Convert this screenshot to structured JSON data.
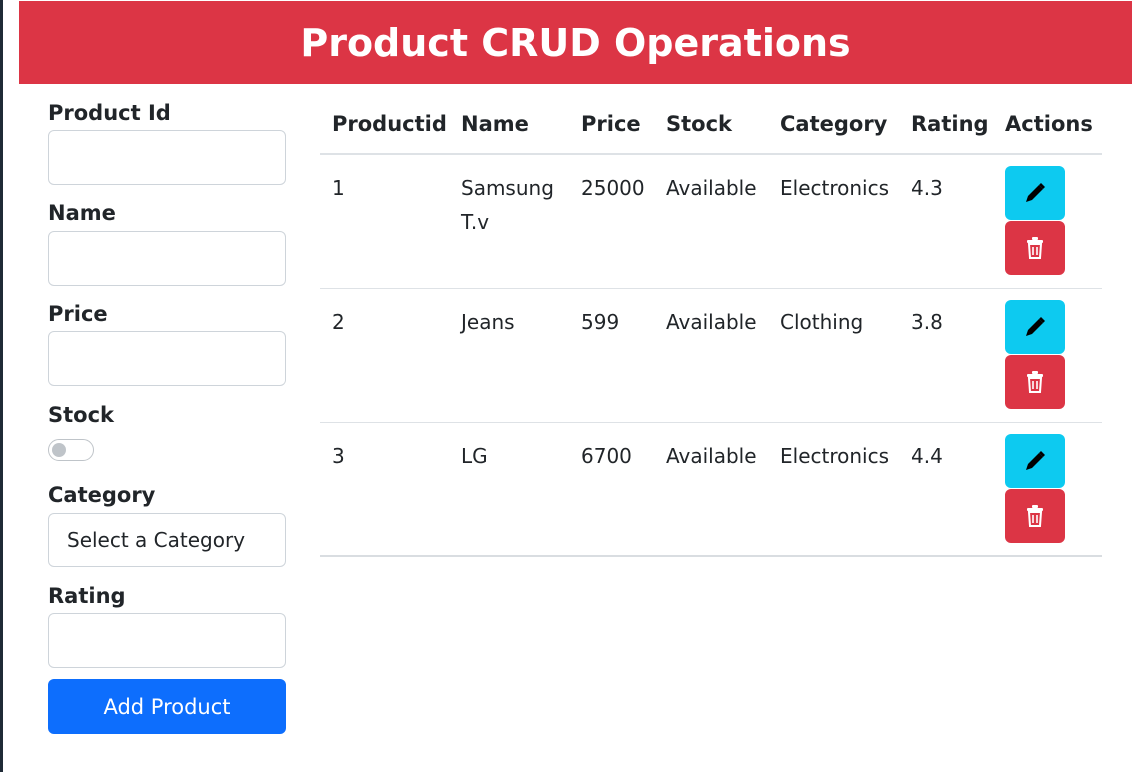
{
  "header": {
    "title": "Product CRUD Operations"
  },
  "form": {
    "product_id_label": "Product Id",
    "product_id_value": "",
    "name_label": "Name",
    "name_value": "",
    "price_label": "Price",
    "price_value": "",
    "stock_label": "Stock",
    "stock_toggle_on": false,
    "category_label": "Category",
    "category_selected": "Select a Category",
    "rating_label": "Rating",
    "rating_value": "",
    "add_button_label": "Add Product"
  },
  "table": {
    "columns": [
      "Productid",
      "Name",
      "Price",
      "Stock",
      "Category",
      "Rating",
      "Actions"
    ],
    "rows": [
      {
        "id": "1",
        "name": "Samsung T.v",
        "price": "25000",
        "stock": "Available",
        "category": "Electronics",
        "rating": "4.3"
      },
      {
        "id": "2",
        "name": "Jeans",
        "price": "599",
        "stock": "Available",
        "category": "Clothing",
        "rating": "3.8"
      },
      {
        "id": "3",
        "name": "LG",
        "price": "6700",
        "stock": "Available",
        "category": "Electronics",
        "rating": "4.4"
      }
    ],
    "edit_icon": "pencil-icon",
    "delete_icon": "trash-icon"
  },
  "colors": {
    "header_bg": "#dc3545",
    "primary": "#0d6efd",
    "info": "#0dcaf0",
    "danger": "#dc3545"
  }
}
